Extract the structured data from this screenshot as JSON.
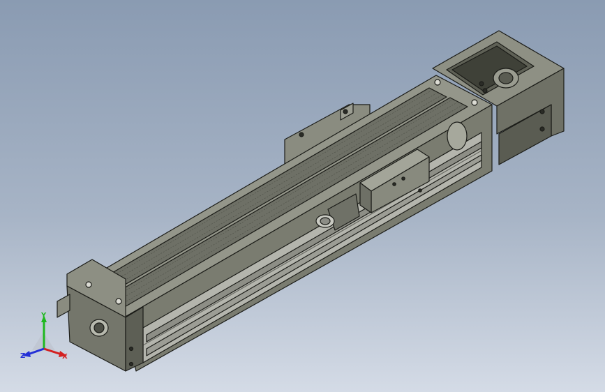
{
  "viewport": {
    "background_top": "#8a9bb2",
    "background_bottom": "#d4dbe6",
    "model": "linear-actuator-module"
  },
  "triad": {
    "x_label": "X",
    "y_label": "Y",
    "z_label": "Z",
    "x_color": "#d42020",
    "y_color": "#1fb81f",
    "z_color": "#2430d6"
  },
  "colors": {
    "body_light": "#94968a",
    "body_mid": "#7a7c70",
    "body_dark": "#55574c",
    "edge": "#1b1c18",
    "rail_light": "#b4b5ad"
  }
}
